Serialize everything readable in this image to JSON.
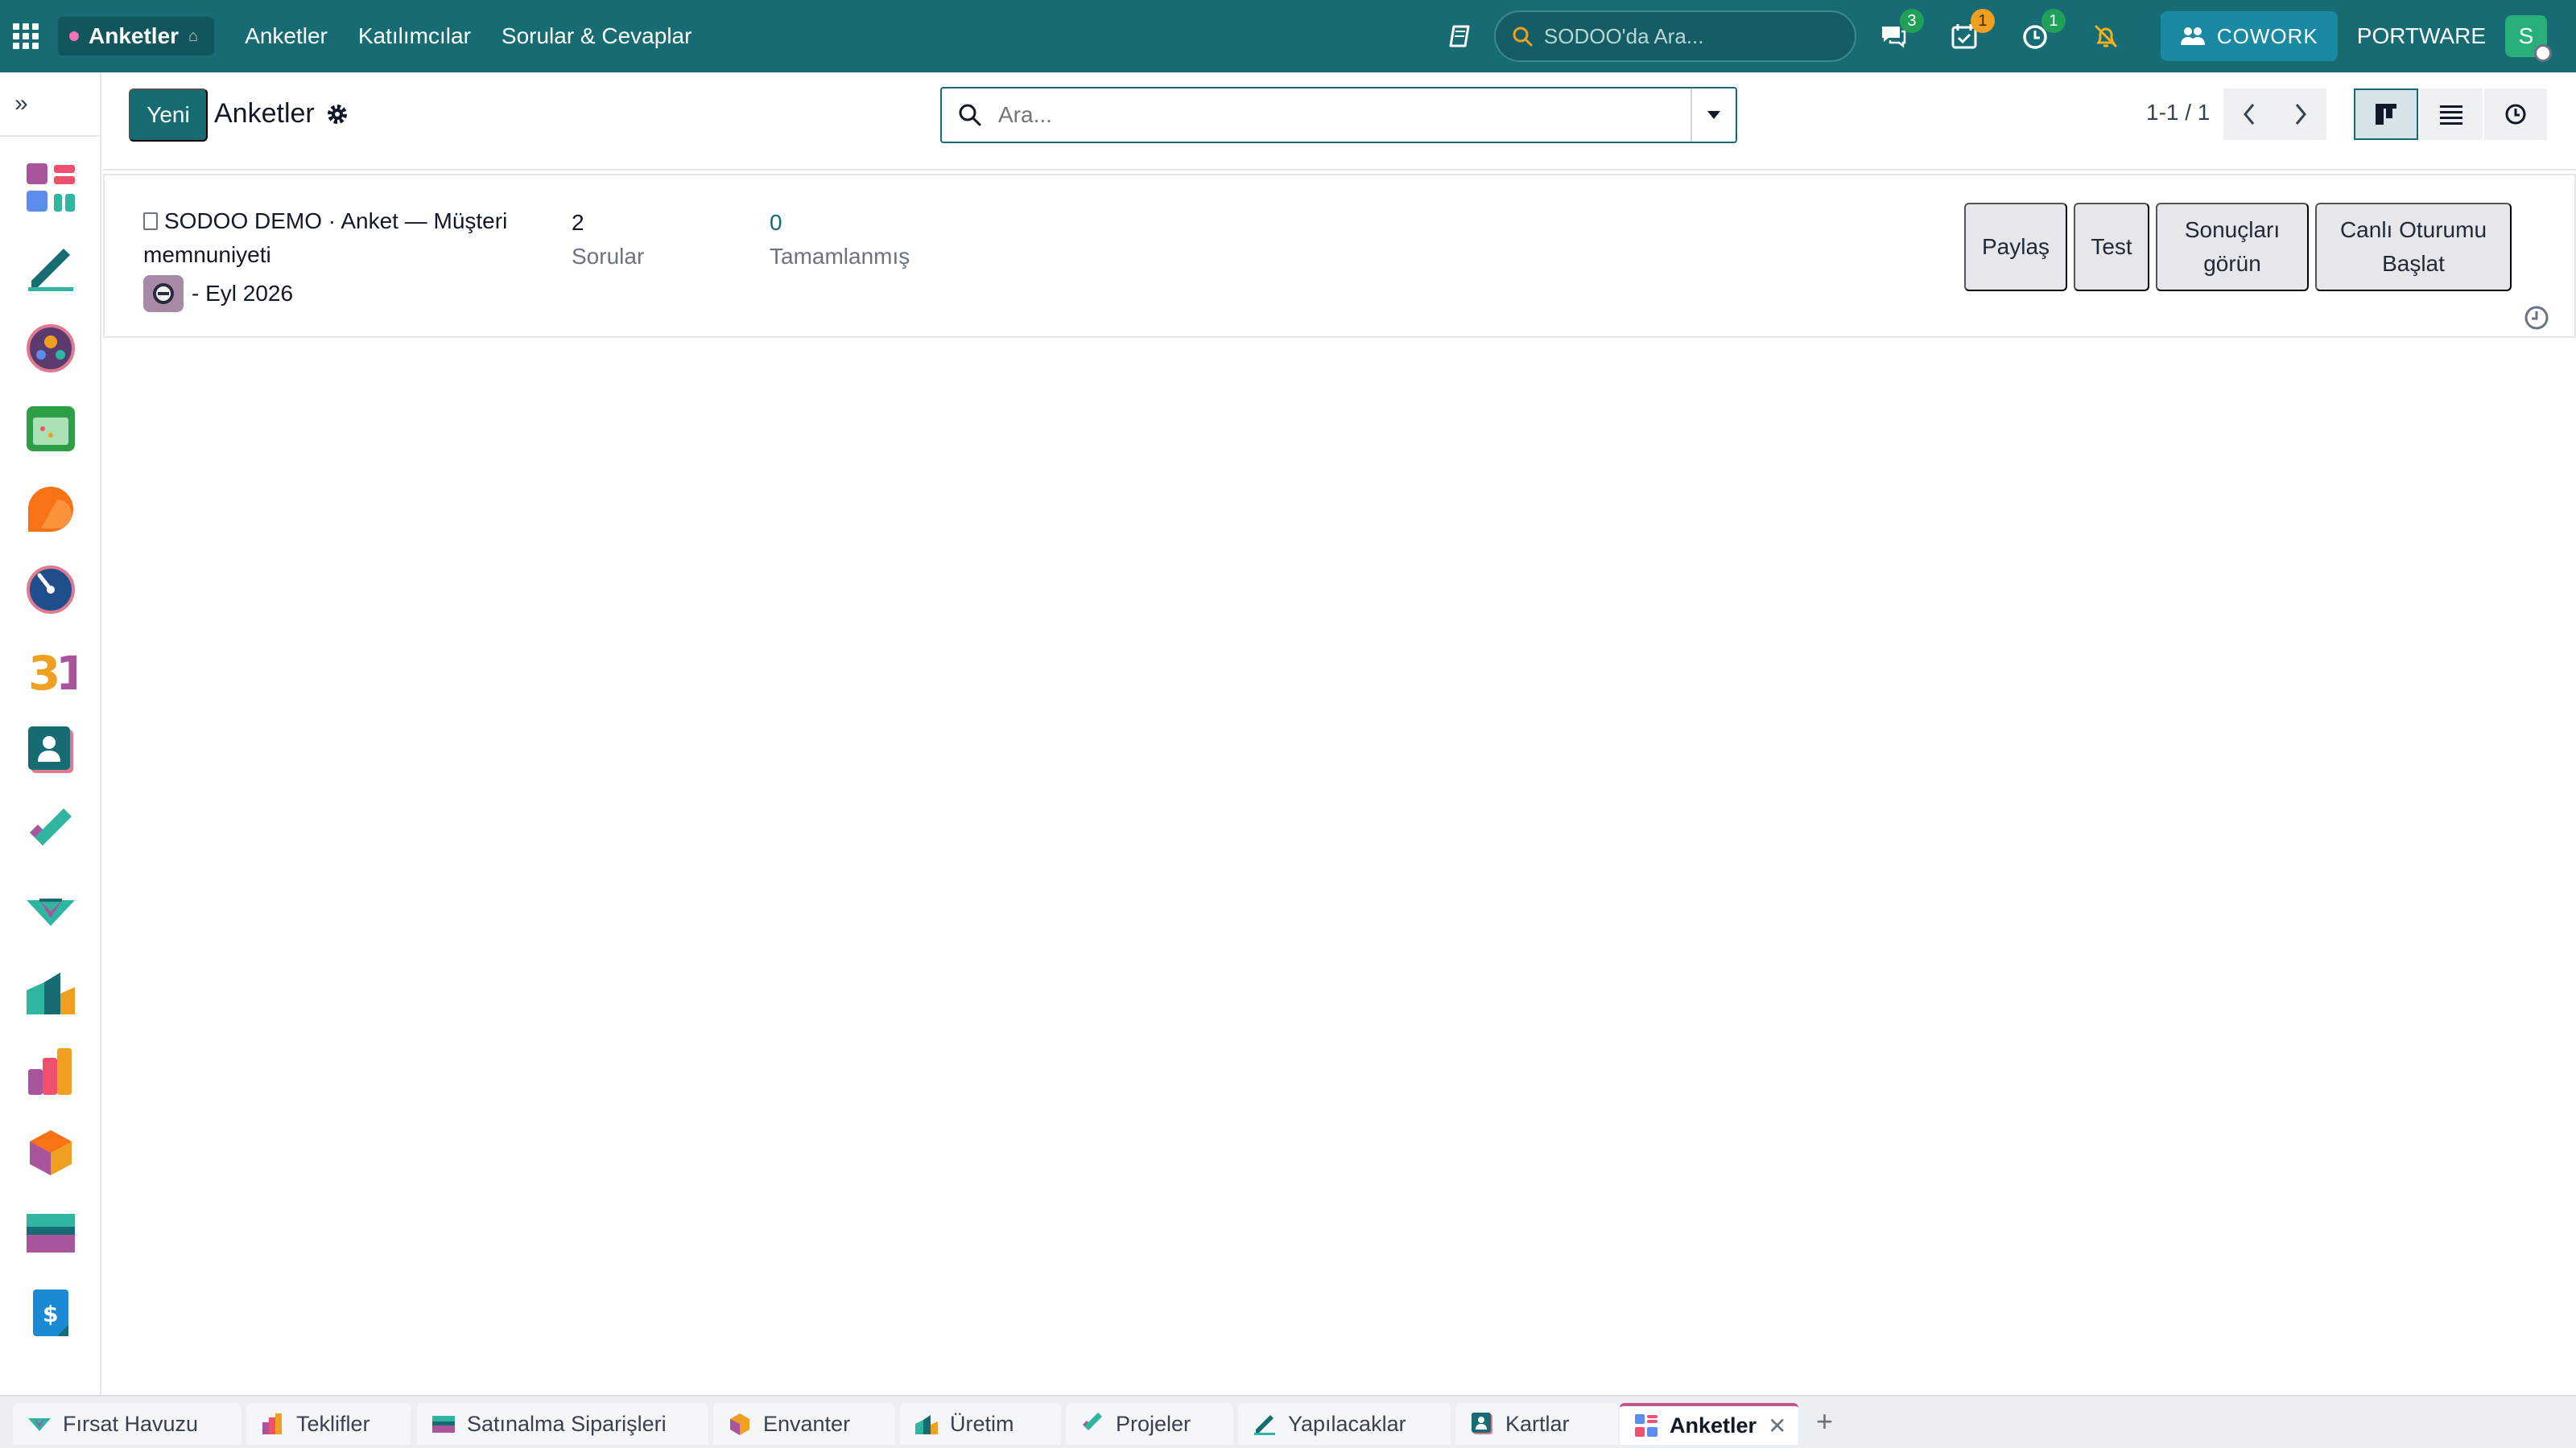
{
  "topbar": {
    "brand": "Anketler",
    "menu": [
      "Anketler",
      "Katılımcılar",
      "Sorular & Cevaplar"
    ],
    "search_placeholder": "SODOO'da Ara...",
    "badges": {
      "messages": "3",
      "activities": "1",
      "timers": "1"
    },
    "cowork_label": "COWORK",
    "company": "PORTWARE",
    "user_initial": "S"
  },
  "control": {
    "new_label": "Yeni",
    "title": "Anketler",
    "search_placeholder": "Ara...",
    "pager": "1-1 / 1"
  },
  "record": {
    "title": "SODOO DEMO · Anket — Müşteri memnuniyeti",
    "date": "- Eyl 2026",
    "questions_count": "2",
    "questions_label": "Sorular",
    "completed_count": "0",
    "completed_label": "Tamamlanmış",
    "actions": {
      "share": "Paylaş",
      "test": "Test",
      "results": "Sonuçları görün",
      "live": "Canlı Oturumu Başlat"
    }
  },
  "tabs": [
    {
      "label": "Fırsat Havuzu",
      "icon": "crm-icon"
    },
    {
      "label": "Teklifler",
      "icon": "sales-icon"
    },
    {
      "label": "Satınalma Siparişleri",
      "icon": "purchase-icon"
    },
    {
      "label": "Envanter",
      "icon": "inventory-icon"
    },
    {
      "label": "Üretim",
      "icon": "manufacturing-icon"
    },
    {
      "label": "Projeler",
      "icon": "project-icon"
    },
    {
      "label": "Yapılacaklar",
      "icon": "todo-icon"
    },
    {
      "label": "Kartlar",
      "icon": "contacts-icon"
    },
    {
      "label": "Anketler",
      "icon": "surveys-icon",
      "active": true
    }
  ],
  "sidebar_apps": [
    "surveys-icon",
    "todo-icon",
    "members-icon",
    "calendar-icon",
    "discuss-icon",
    "dashboard-icon",
    "calendar-31-icon",
    "contacts-icon",
    "project-icon",
    "crm-icon",
    "manufacturing-icon",
    "sales-icon",
    "inventory-icon",
    "purchase-icon",
    "invoicing-icon"
  ],
  "colors": {
    "primary": "#176b73",
    "accent": "#c2578f"
  }
}
